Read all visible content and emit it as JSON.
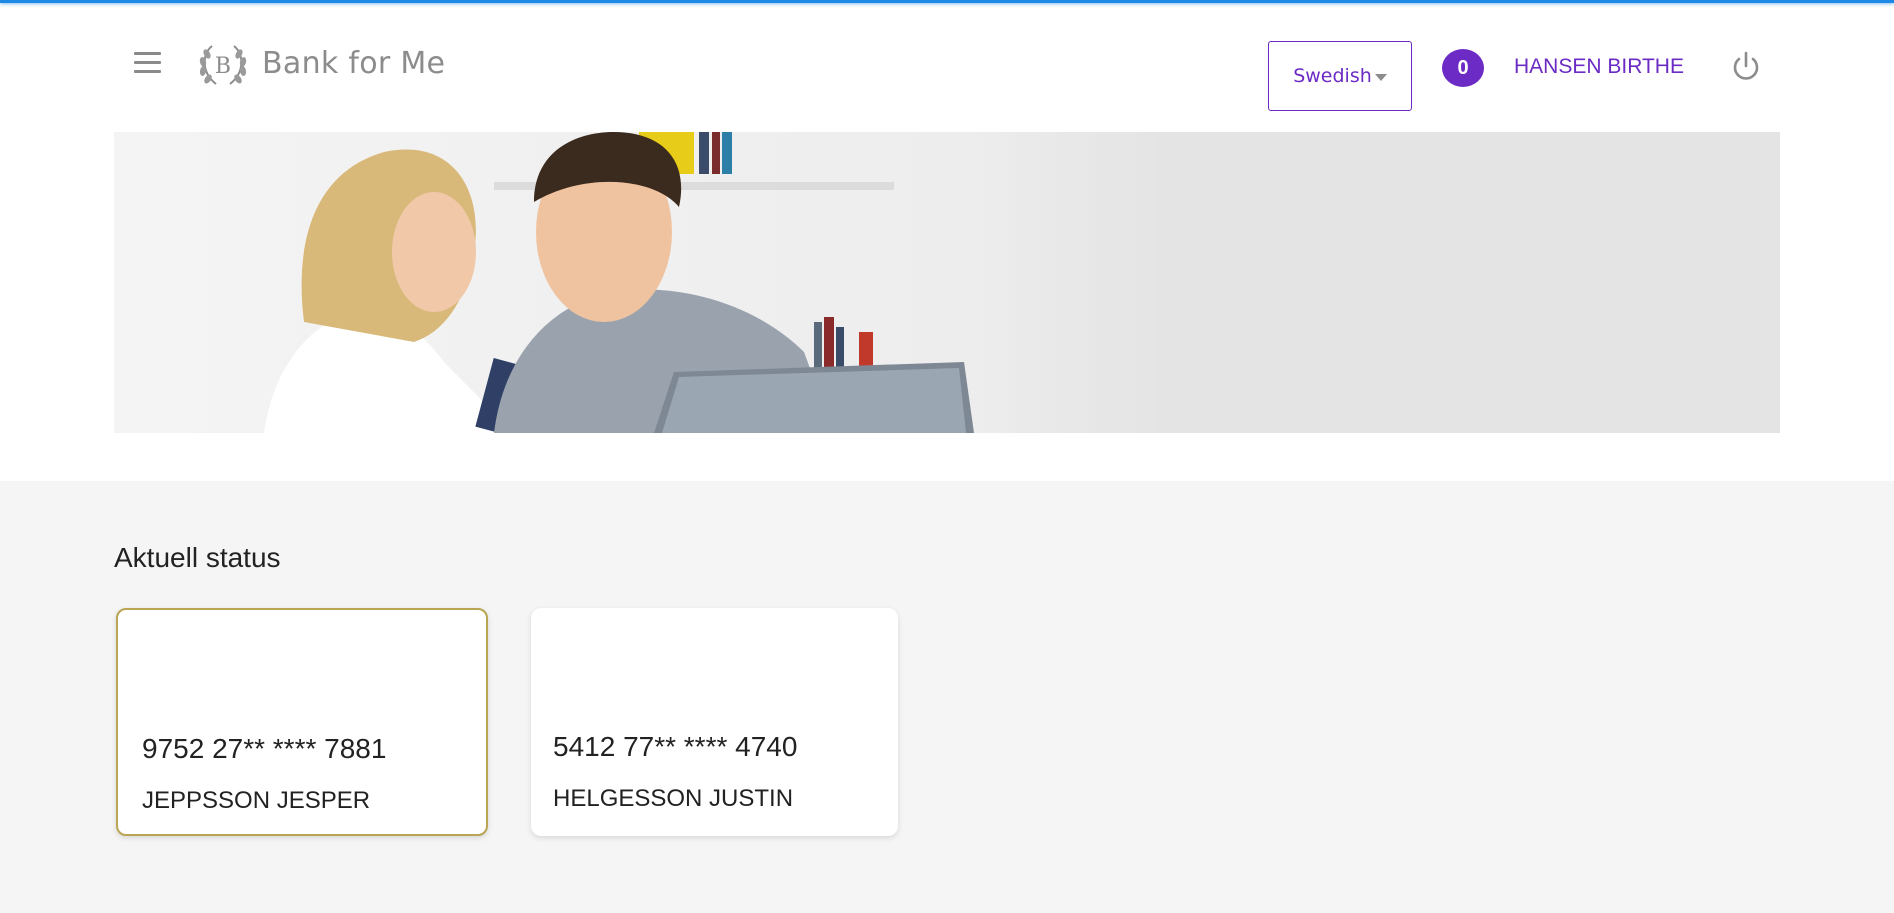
{
  "header": {
    "brand_name": "Bank for Me",
    "logo_letter": "B",
    "language_select": {
      "selected": "Swedish"
    },
    "notifications": {
      "count": "0"
    },
    "user_name": "HANSEN BIRTHE"
  },
  "main": {
    "section_title": "Aktuell status",
    "cards": [
      {
        "number": "9752 27** **** 7881",
        "holder": "JEPPSSON JESPER",
        "selected": true
      },
      {
        "number": "5412 77** **** 4740",
        "holder": "HELGESSON JUSTIN",
        "selected": false
      }
    ]
  },
  "colors": {
    "accent": "#6c2bc4",
    "top_bar": "#1e88e5",
    "selected_card_border": "#b9a552",
    "page_background": "#f5f5f5"
  },
  "icons": {
    "menu": "hamburger-menu-icon",
    "logo": "laurel-emblem-logo",
    "dropdown": "caret-down-icon",
    "logout": "power-icon"
  }
}
